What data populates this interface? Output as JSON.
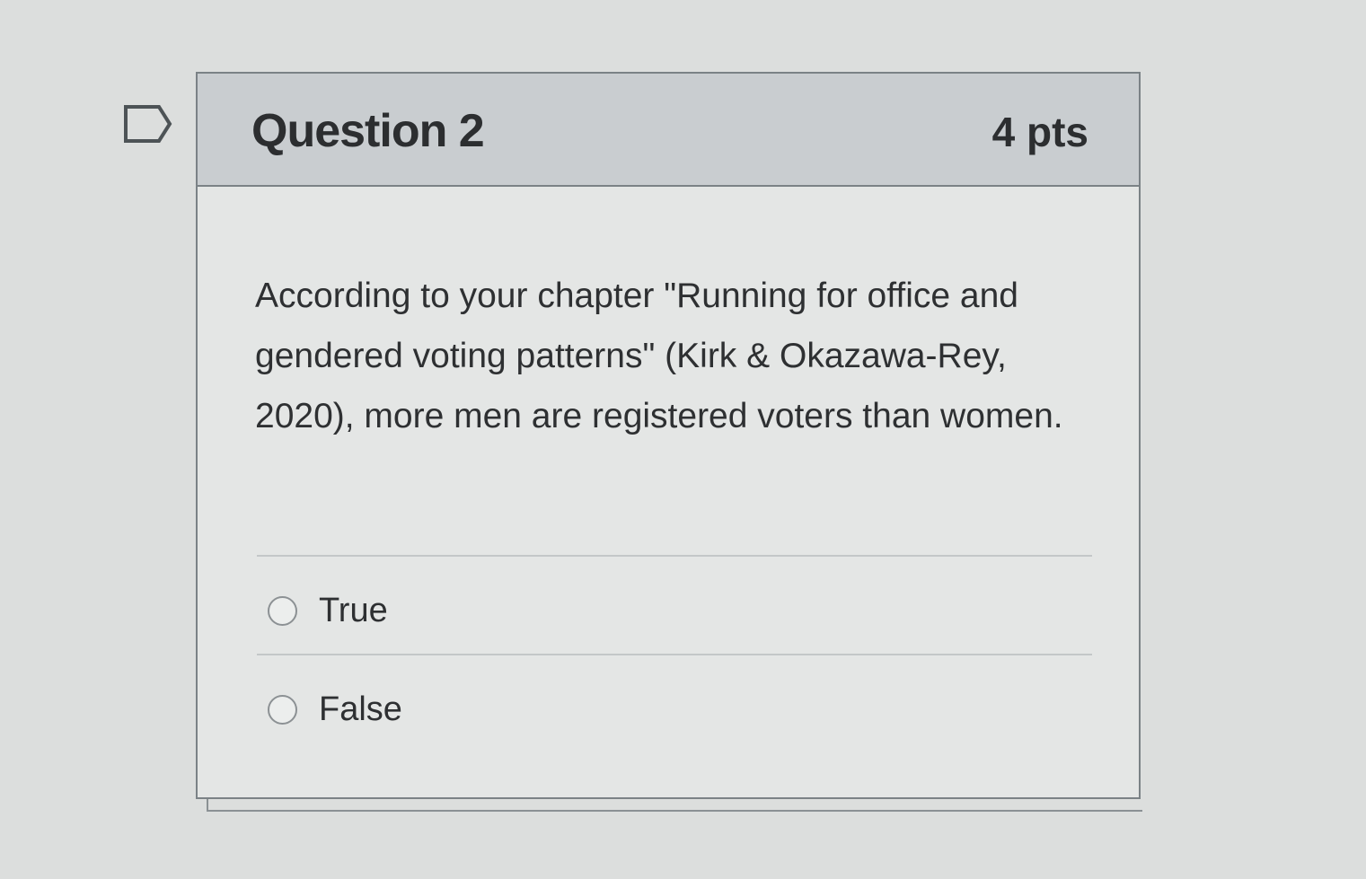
{
  "question": {
    "title": "Question 2",
    "points": "4 pts",
    "text": "According to your chapter \"Running for office and gendered voting patterns\" (Kirk & Okazawa-Rey, 2020), more men are registered voters than women.",
    "flag_icon": "bookmark-flag-icon"
  },
  "answers": [
    {
      "label": "True",
      "selected": false
    },
    {
      "label": "False",
      "selected": false
    }
  ],
  "colors": {
    "header_background": "#c9cdd0",
    "card_background": "#e4e6e5",
    "border": "#7b8286",
    "text": "#2e3032"
  }
}
